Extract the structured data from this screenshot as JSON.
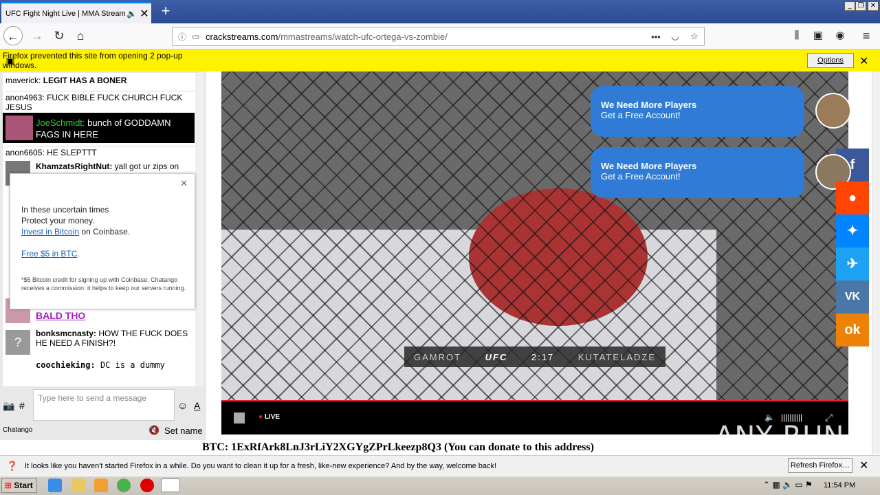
{
  "browser": {
    "tab_title": "UFC Fight Night Live | MMA Stream",
    "url_host": "crackstreams.com",
    "url_path": "/mmastreams/watch-ufc-ortega-vs-zombie/",
    "popup_message": "Firefox prevented this site from opening 2 pop-up windows.",
    "options_label": "Options",
    "refresh_message": "It looks like you haven't started Firefox in a while. Do you want to clean it up for a fresh, like-new experience? And by the way, welcome back!",
    "refresh_label": "Refresh Firefox…"
  },
  "chat": {
    "messages": [
      {
        "user": "maverick:",
        "text": "LEGIT HAS A BONER"
      },
      {
        "user": "anon4963:",
        "text": "FUCK BIBLE FUCK CHURCH FUCK JESUS"
      },
      {
        "user": "JoeSchmidt:",
        "text": "bunch of GODDAMN FAGS IN HERE"
      },
      {
        "user": "anon6605:",
        "text": "HE SLEPTTT"
      },
      {
        "user": "KhamzatsRightNut:",
        "text": "yall got ur zips on"
      },
      {
        "user": "",
        "text": "BALD THO"
      },
      {
        "user": "bonksmcnasty:",
        "text": "HOW THE FUCK DOES HE NEED A FINISH?!"
      },
      {
        "user": "coochieking:",
        "text": "DC is a dummy"
      }
    ],
    "ad": {
      "line1": "In these uncertain times",
      "line2": "Protect your money.",
      "link1": "Invest in Bitcoin",
      "after_link1": "on Coinbase.",
      "link2": "Free $5 in BTC",
      "fine_print": "*$5 Bitcoin credit for signing up with Coinbase. Chatango receives a commission: it helps to keep our servers running."
    },
    "input_placeholder": "Type here to send a message",
    "hash": "#",
    "brand": "Chatango",
    "set_name": "Set name"
  },
  "video": {
    "fighter_left": "GAMROT",
    "fighter_right": "KUTATELADZE",
    "league": "UFC",
    "clock": "2:17",
    "live_label": "LIVE"
  },
  "bubbles": [
    {
      "title": "We Need More Players",
      "subtitle": "Get a Free Account!"
    },
    {
      "title": "We Need More Players",
      "subtitle": "Get a Free Account!"
    }
  ],
  "social": [
    {
      "name": "facebook",
      "glyph": "f",
      "color": "#3b5998"
    },
    {
      "name": "reddit",
      "glyph": "●",
      "color": "#ff4500"
    },
    {
      "name": "messenger",
      "glyph": "✦",
      "color": "#0084ff"
    },
    {
      "name": "twitter",
      "glyph": "✈",
      "color": "#1da1f2"
    },
    {
      "name": "vk",
      "glyph": "VK",
      "color": "#4a76a8"
    },
    {
      "name": "odnoklassniki",
      "glyph": "ok",
      "color": "#ee8208"
    }
  ],
  "btc_text": "BTC: 1ExRfArk8LnJ3rLiY2XGYgZPrLkeezp8Q3 (You can donate to this address)",
  "watermark": "ANY RUN",
  "taskbar": {
    "start": "Start",
    "clock": "11:54 PM"
  }
}
